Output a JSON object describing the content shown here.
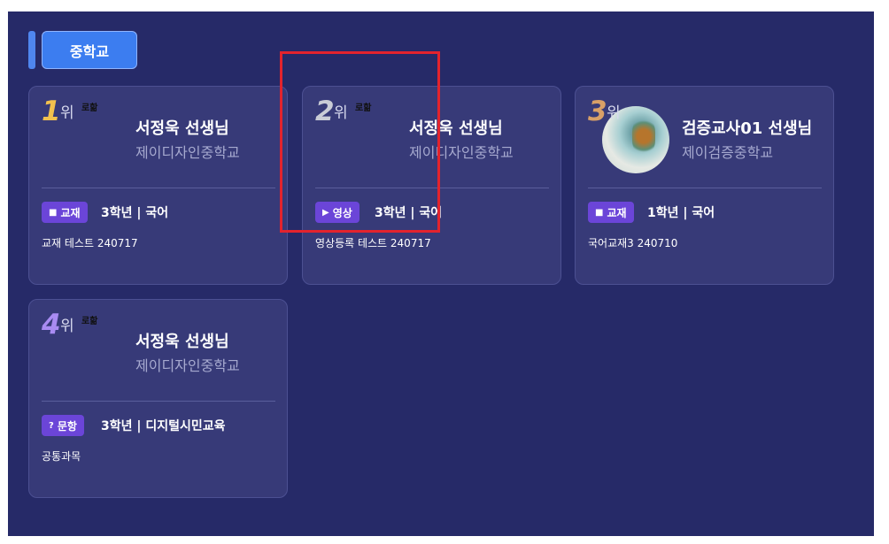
{
  "section": {
    "label": "중학교"
  },
  "cards": [
    {
      "rank": "1",
      "rank_suffix": "위",
      "logo_text": "로핢",
      "teacher": "서정욱 선생님",
      "school": "제이디자인중학교",
      "badge_icon": "■",
      "badge_label": "교재",
      "grade": "3학년 | 국어",
      "title": "교재 테스트 240717",
      "rank_color": "#f2c14e"
    },
    {
      "rank": "2",
      "rank_suffix": "위",
      "logo_text": "로핢",
      "teacher": "서정욱 선생님",
      "school": "제이디자인중학교",
      "badge_icon": "▶",
      "badge_label": "영상",
      "grade": "3학년 | 국어",
      "title": "영상등록 테스트 240717",
      "rank_color": "#c9ccd6"
    },
    {
      "rank": "3",
      "rank_suffix": "위",
      "logo_text": "",
      "teacher": "검증교사01 선생님",
      "school": "제이검증중학교",
      "badge_icon": "■",
      "badge_label": "교재",
      "grade": "1학년 | 국어",
      "title": "국어교재3 240710",
      "rank_color": "#d9a067"
    },
    {
      "rank": "4",
      "rank_suffix": "위",
      "logo_text": "로핢",
      "teacher": "서정욱 선생님",
      "school": "제이디자인중학교",
      "badge_icon": "?",
      "badge_label": "문항",
      "grade": "3학년 | 디지털시민교육",
      "title": "공통과목",
      "rank_color": "#a98bf2"
    }
  ]
}
